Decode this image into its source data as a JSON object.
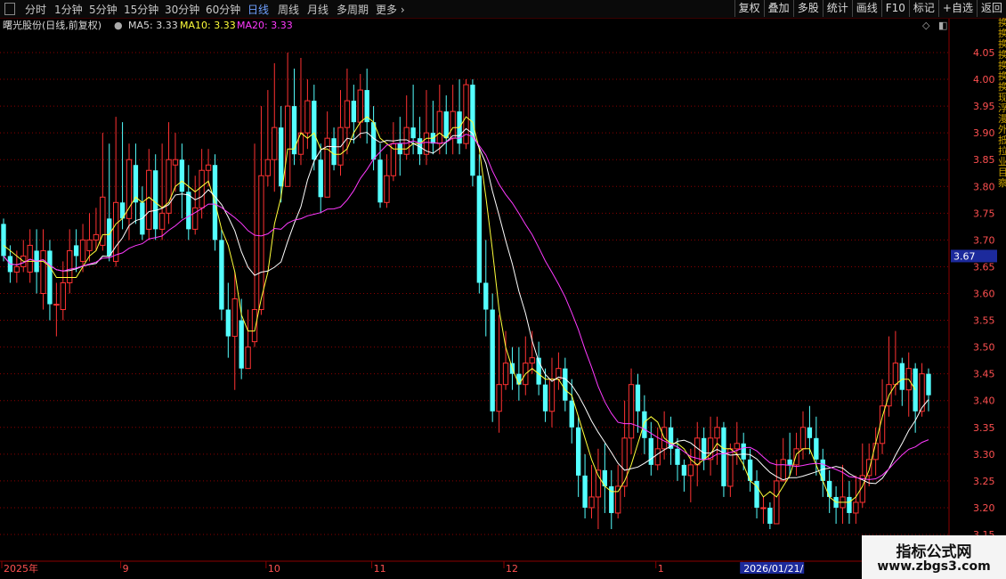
{
  "toolbar": {
    "tabs": [
      {
        "label": "分时",
        "active": false
      },
      {
        "label": "1分钟",
        "active": false
      },
      {
        "label": "5分钟",
        "active": false
      },
      {
        "label": "15分钟",
        "active": false
      },
      {
        "label": "30分钟",
        "active": false
      },
      {
        "label": "60分钟",
        "active": false
      },
      {
        "label": "日线",
        "active": true
      },
      {
        "label": "周线",
        "active": false
      },
      {
        "label": "月线",
        "active": false
      },
      {
        "label": "多周期",
        "active": false
      },
      {
        "label": "更多",
        "active": false
      }
    ],
    "right_buttons": [
      "复权",
      "叠加",
      "多股",
      "统计",
      "画线",
      "F10",
      "标记",
      "+自选",
      "返回"
    ]
  },
  "info": {
    "stock_name": "曙光股份(日线,前复权)",
    "ma5_label": "MA5: 3.33",
    "ma10_label": "MA10: 3.33",
    "ma20_label": "MA20: 3.33"
  },
  "colors": {
    "up": "#ff3232",
    "down": "#54ffff",
    "ma5": "#ffff3a",
    "ma10": "#ffffff",
    "ma20": "#ff3aff",
    "grid": "#8b0000",
    "axis_text": "#ff5050",
    "price_tag_bg": "#1c2a9c"
  },
  "right_strip_text": [
    "换",
    "换",
    "换",
    "换",
    "换",
    "换",
    "换",
    "现",
    "浮",
    "漫",
    "外",
    "抵",
    "拉",
    "业",
    "目",
    "察"
  ],
  "watermark": {
    "line1": "指标公式网",
    "line2": "www.zbgs3.com"
  },
  "chart_data": {
    "type": "candlestick",
    "ylim": [
      3.15,
      4.1
    ],
    "y_ticks": [
      3.15,
      3.2,
      3.25,
      3.3,
      3.35,
      3.4,
      3.45,
      3.5,
      3.55,
      3.6,
      3.65,
      3.7,
      3.75,
      3.8,
      3.85,
      3.9,
      3.95,
      4.0,
      4.05
    ],
    "x_labels": [
      {
        "label": "2025年",
        "index": 0
      },
      {
        "label": "9",
        "index": 18
      },
      {
        "label": "10",
        "index": 40
      },
      {
        "label": "11",
        "index": 56
      },
      {
        "label": "12",
        "index": 76
      },
      {
        "label": "1",
        "index": 99
      },
      {
        "label": "2026/01/21/",
        "index": 112
      }
    ],
    "current_price_tag": "3.67",
    "series_names": [
      "MA5",
      "MA10",
      "MA20"
    ],
    "candles": [
      [
        3.73,
        3.67,
        3.74,
        3.66
      ],
      [
        3.67,
        3.64,
        3.69,
        3.62
      ],
      [
        3.64,
        3.65,
        3.68,
        3.62
      ],
      [
        3.65,
        3.67,
        3.7,
        3.64
      ],
      [
        3.64,
        3.69,
        3.72,
        3.62
      ],
      [
        3.68,
        3.64,
        3.72,
        3.6
      ],
      [
        3.6,
        3.68,
        3.72,
        3.57
      ],
      [
        3.68,
        3.58,
        3.7,
        3.55
      ],
      [
        3.58,
        3.58,
        3.62,
        3.52
      ],
      [
        3.57,
        3.62,
        3.66,
        3.55
      ],
      [
        3.62,
        3.68,
        3.72,
        3.6
      ],
      [
        3.69,
        3.67,
        3.72,
        3.64
      ],
      [
        3.66,
        3.7,
        3.73,
        3.64
      ],
      [
        3.68,
        3.7,
        3.75,
        3.66
      ],
      [
        3.7,
        3.71,
        3.76,
        3.68
      ],
      [
        3.69,
        3.78,
        3.9,
        3.68
      ],
      [
        3.74,
        3.67,
        3.88,
        3.66
      ],
      [
        3.66,
        3.77,
        3.93,
        3.65
      ],
      [
        3.77,
        3.74,
        3.92,
        3.72
      ],
      [
        3.74,
        3.85,
        3.88,
        3.7
      ],
      [
        3.84,
        3.77,
        3.88,
        3.73
      ],
      [
        3.77,
        3.71,
        3.8,
        3.7
      ],
      [
        3.72,
        3.83,
        3.87,
        3.7
      ],
      [
        3.83,
        3.72,
        3.86,
        3.7
      ],
      [
        3.72,
        3.75,
        3.88,
        3.7
      ],
      [
        3.75,
        3.85,
        3.92,
        3.73
      ],
      [
        3.84,
        3.85,
        3.9,
        3.79
      ],
      [
        3.85,
        3.79,
        3.88,
        3.74
      ],
      [
        3.79,
        3.72,
        3.84,
        3.7
      ],
      [
        3.72,
        3.76,
        3.82,
        3.71
      ],
      [
        3.76,
        3.83,
        3.87,
        3.74
      ],
      [
        3.83,
        3.84,
        3.87,
        3.8
      ],
      [
        3.84,
        3.7,
        3.86,
        3.68
      ],
      [
        3.7,
        3.57,
        3.72,
        3.55
      ],
      [
        3.57,
        3.52,
        3.62,
        3.48
      ],
      [
        3.52,
        3.59,
        3.64,
        3.42
      ],
      [
        3.55,
        3.46,
        3.59,
        3.44
      ],
      [
        3.46,
        3.5,
        3.57,
        3.47
      ],
      [
        3.51,
        3.57,
        3.88,
        3.5
      ],
      [
        3.57,
        3.82,
        3.95,
        3.56
      ],
      [
        3.82,
        3.85,
        3.98,
        3.8
      ],
      [
        3.85,
        3.91,
        4.03,
        3.79
      ],
      [
        3.91,
        3.8,
        3.95,
        3.77
      ],
      [
        3.8,
        3.95,
        4.05,
        3.8
      ],
      [
        3.95,
        3.86,
        4.02,
        3.84
      ],
      [
        3.86,
        3.9,
        4.04,
        3.84
      ],
      [
        3.9,
        3.96,
        4.0,
        3.87
      ],
      [
        3.96,
        3.85,
        3.99,
        3.83
      ],
      [
        3.85,
        3.78,
        3.88,
        3.75
      ],
      [
        3.78,
        3.89,
        3.94,
        3.78
      ],
      [
        3.89,
        3.84,
        3.91,
        3.83
      ],
      [
        3.84,
        3.91,
        3.98,
        3.82
      ],
      [
        3.91,
        3.96,
        4.02,
        3.86
      ],
      [
        3.96,
        3.92,
        3.99,
        3.88
      ],
      [
        3.92,
        3.98,
        4.01,
        3.89
      ],
      [
        3.98,
        3.92,
        4.02,
        3.88
      ],
      [
        3.92,
        3.85,
        3.95,
        3.83
      ],
      [
        3.85,
        3.77,
        3.88,
        3.76
      ],
      [
        3.77,
        3.82,
        3.86,
        3.76
      ],
      [
        3.82,
        3.88,
        3.92,
        3.81
      ],
      [
        3.88,
        3.86,
        3.93,
        3.82
      ],
      [
        3.86,
        3.91,
        3.97,
        3.85
      ],
      [
        3.91,
        3.89,
        3.99,
        3.86
      ],
      [
        3.89,
        3.86,
        3.93,
        3.84
      ],
      [
        3.86,
        3.9,
        3.98,
        3.84
      ],
      [
        3.9,
        3.88,
        3.96,
        3.86
      ],
      [
        3.88,
        3.94,
        3.99,
        3.86
      ],
      [
        3.94,
        3.89,
        3.97,
        3.86
      ],
      [
        3.89,
        3.94,
        3.99,
        3.86
      ],
      [
        3.94,
        3.88,
        4.0,
        3.86
      ],
      [
        3.88,
        3.99,
        4.0,
        3.87
      ],
      [
        3.99,
        3.82,
        4.0,
        3.8
      ],
      [
        3.82,
        3.62,
        3.86,
        3.6
      ],
      [
        3.62,
        3.57,
        3.7,
        3.52
      ],
      [
        3.57,
        3.38,
        3.6,
        3.36
      ],
      [
        3.38,
        3.43,
        3.56,
        3.34
      ],
      [
        3.43,
        3.47,
        3.53,
        3.42
      ],
      [
        3.47,
        3.45,
        3.5,
        3.42
      ],
      [
        3.45,
        3.43,
        3.5,
        3.4
      ],
      [
        3.43,
        3.47,
        3.52,
        3.41
      ],
      [
        3.47,
        3.48,
        3.53,
        3.45
      ],
      [
        3.48,
        3.43,
        3.51,
        3.41
      ],
      [
        3.43,
        3.38,
        3.46,
        3.36
      ],
      [
        3.38,
        3.44,
        3.48,
        3.35
      ],
      [
        3.44,
        3.46,
        3.49,
        3.42
      ],
      [
        3.46,
        3.4,
        3.48,
        3.38
      ],
      [
        3.4,
        3.35,
        3.44,
        3.32
      ],
      [
        3.35,
        3.26,
        3.37,
        3.22
      ],
      [
        3.26,
        3.2,
        3.3,
        3.18
      ],
      [
        3.2,
        3.22,
        3.28,
        3.18
      ],
      [
        3.22,
        3.27,
        3.31,
        3.16
      ],
      [
        3.27,
        3.24,
        3.32,
        3.19
      ],
      [
        3.24,
        3.19,
        3.27,
        3.16
      ],
      [
        3.19,
        3.24,
        3.28,
        3.18
      ],
      [
        3.24,
        3.33,
        3.4,
        3.22
      ],
      [
        3.33,
        3.43,
        3.46,
        3.3
      ],
      [
        3.43,
        3.38,
        3.45,
        3.34
      ],
      [
        3.38,
        3.33,
        3.41,
        3.3
      ],
      [
        3.33,
        3.28,
        3.36,
        3.26
      ],
      [
        3.28,
        3.31,
        3.35,
        3.27
      ],
      [
        3.31,
        3.35,
        3.38,
        3.29
      ],
      [
        3.35,
        3.31,
        3.37,
        3.28
      ],
      [
        3.31,
        3.28,
        3.33,
        3.25
      ],
      [
        3.28,
        3.26,
        3.29,
        3.23
      ],
      [
        3.26,
        3.28,
        3.31,
        3.21
      ],
      [
        3.28,
        3.33,
        3.36,
        3.24
      ],
      [
        3.33,
        3.29,
        3.35,
        3.27
      ],
      [
        3.29,
        3.33,
        3.37,
        3.26
      ],
      [
        3.33,
        3.35,
        3.37,
        3.28
      ],
      [
        3.35,
        3.24,
        3.36,
        3.22
      ],
      [
        3.24,
        3.31,
        3.32,
        3.22
      ],
      [
        3.31,
        3.32,
        3.36,
        3.28
      ],
      [
        3.32,
        3.29,
        3.34,
        3.27
      ],
      [
        3.29,
        3.25,
        3.31,
        3.23
      ],
      [
        3.25,
        3.2,
        3.27,
        3.18
      ],
      [
        3.2,
        3.2,
        3.22,
        3.17
      ],
      [
        3.2,
        3.17,
        3.21,
        3.16
      ],
      [
        3.17,
        3.25,
        3.29,
        3.17
      ],
      [
        3.25,
        3.29,
        3.33,
        3.25
      ],
      [
        3.29,
        3.28,
        3.34,
        3.26
      ],
      [
        3.28,
        3.31,
        3.34,
        3.26
      ],
      [
        3.31,
        3.35,
        3.38,
        3.29
      ],
      [
        3.35,
        3.33,
        3.39,
        3.3
      ],
      [
        3.33,
        3.29,
        3.37,
        3.26
      ],
      [
        3.29,
        3.25,
        3.31,
        3.22
      ],
      [
        3.25,
        3.22,
        3.27,
        3.19
      ],
      [
        3.22,
        3.2,
        3.24,
        3.17
      ],
      [
        3.2,
        3.22,
        3.28,
        3.17
      ],
      [
        3.22,
        3.19,
        3.25,
        3.17
      ],
      [
        3.19,
        3.21,
        3.26,
        3.17
      ],
      [
        3.21,
        3.26,
        3.32,
        3.2
      ],
      [
        3.26,
        3.29,
        3.32,
        3.24
      ],
      [
        3.29,
        3.32,
        3.35,
        3.26
      ],
      [
        3.32,
        3.39,
        3.44,
        3.3
      ],
      [
        3.39,
        3.43,
        3.52,
        3.37
      ],
      [
        3.43,
        3.47,
        3.53,
        3.41
      ],
      [
        3.47,
        3.42,
        3.48,
        3.39
      ],
      [
        3.42,
        3.46,
        3.49,
        3.37
      ],
      [
        3.46,
        3.38,
        3.47,
        3.34
      ],
      [
        3.38,
        3.45,
        3.47,
        3.37
      ],
      [
        3.45,
        3.41,
        3.46,
        3.38
      ]
    ],
    "ma5": [
      3.69,
      3.68,
      3.67,
      3.66,
      3.66,
      3.66,
      3.66,
      3.65,
      3.63,
      3.63,
      3.63,
      3.63,
      3.65,
      3.67,
      3.68,
      3.71,
      3.71,
      3.73,
      3.74,
      3.76,
      3.78,
      3.77,
      3.78,
      3.77,
      3.76,
      3.77,
      3.8,
      3.81,
      3.8,
      3.79,
      3.8,
      3.81,
      3.77,
      3.72,
      3.69,
      3.64,
      3.56,
      3.53,
      3.53,
      3.59,
      3.64,
      3.73,
      3.78,
      3.87,
      3.87,
      3.9,
      3.89,
      3.9,
      3.87,
      3.87,
      3.86,
      3.86,
      3.87,
      3.9,
      3.92,
      3.93,
      3.92,
      3.89,
      3.88,
      3.87,
      3.87,
      3.87,
      3.88,
      3.88,
      3.89,
      3.89,
      3.9,
      3.89,
      3.91,
      3.91,
      3.93,
      3.92,
      3.87,
      3.78,
      3.68,
      3.57,
      3.5,
      3.46,
      3.43,
      3.45,
      3.46,
      3.45,
      3.44,
      3.44,
      3.44,
      3.42,
      3.41,
      3.37,
      3.33,
      3.29,
      3.26,
      3.24,
      3.23,
      3.23,
      3.25,
      3.28,
      3.32,
      3.36,
      3.37,
      3.36,
      3.33,
      3.32,
      3.32,
      3.31,
      3.29,
      3.28,
      3.29,
      3.3,
      3.32,
      3.31,
      3.31,
      3.3,
      3.28,
      3.25,
      3.24,
      3.22,
      3.23,
      3.22,
      3.24,
      3.26,
      3.3,
      3.31,
      3.31,
      3.28,
      3.25,
      3.22,
      3.21,
      3.21,
      3.21,
      3.22,
      3.24,
      3.27,
      3.32,
      3.37,
      3.41,
      3.43,
      3.44,
      3.44,
      3.42
    ]
  }
}
